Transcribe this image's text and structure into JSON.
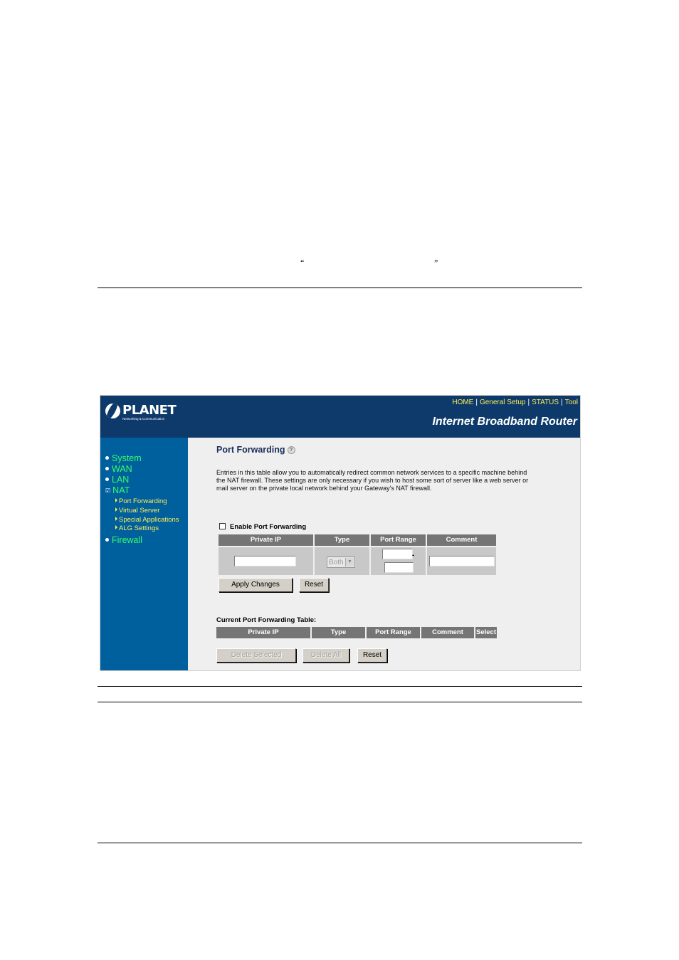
{
  "page": {
    "open_quote": "“",
    "close_quote": "”"
  },
  "router": {
    "logo": {
      "name": "PLANET",
      "tagline": "Networking & Communication"
    },
    "top_nav": {
      "items": [
        "HOME",
        "General Setup",
        "STATUS",
        "Tool"
      ],
      "separator": "|"
    },
    "product_title": "Internet Broadband Router",
    "sidebar": {
      "main": [
        "System",
        "WAN",
        "LAN",
        "NAT",
        "Firewall"
      ],
      "sub": [
        "Port Forwarding",
        "Virtual Server",
        "Special Applications",
        "ALG Settings"
      ],
      "check_glyph": "☑"
    },
    "content": {
      "title": "Port Forwarding",
      "help_glyph": "?",
      "description": "Entries in this table allow you to automatically redirect common network services to a specific machine behind the NAT firewall. These settings are only necessary if you wish to host some sort of server like a web server or mail server on the private local network behind your Gateway's NAT firewall.",
      "enable_label": "Enable Port Forwarding",
      "entry_headers": [
        "Private IP",
        "Type",
        "Port Range",
        "Comment"
      ],
      "type_value": "Both",
      "select_arrow": "▼",
      "range_dash": "-",
      "apply_button": "Apply Changes",
      "reset_button": "Reset",
      "table_caption": "Current Port Forwarding Table:",
      "table_headers": [
        "Private IP",
        "Type",
        "Port Range",
        "Comment",
        "Select"
      ],
      "delete_selected_button": "Delete Selected",
      "delete_all_button": "Delete All",
      "reset2_button": "Reset"
    }
  }
}
